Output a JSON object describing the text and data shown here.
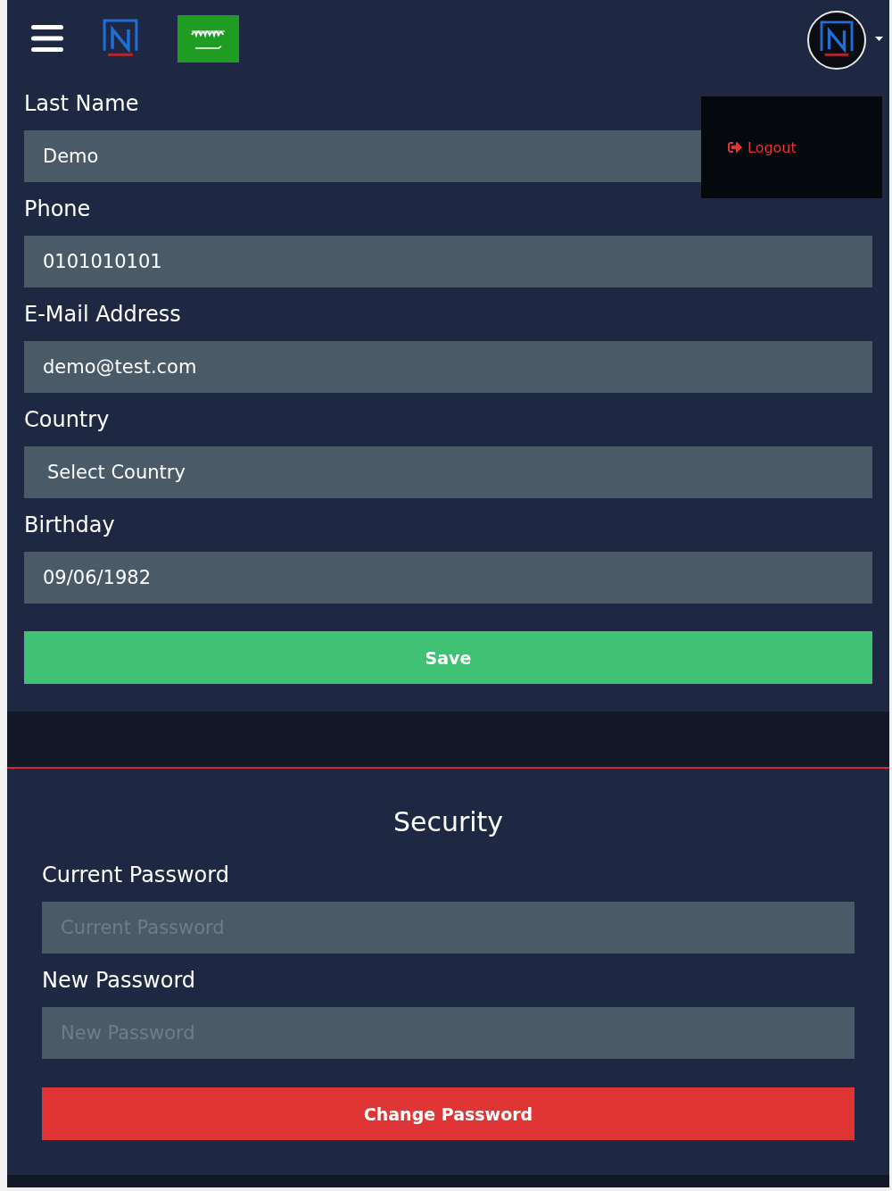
{
  "navbar": {
    "user_menu": {
      "expanded": true,
      "items": [
        {
          "label": "Logout"
        }
      ]
    }
  },
  "profile_form": {
    "fields": [
      {
        "label": "Last Name",
        "kind": "text",
        "value": "Demo"
      },
      {
        "label": "Phone",
        "kind": "text",
        "value": "0101010101"
      },
      {
        "label": "E-Mail Address",
        "kind": "text",
        "value": "demo@test.com"
      },
      {
        "label": "Country",
        "kind": "select",
        "value": "Select Country"
      },
      {
        "label": "Birthday",
        "kind": "text",
        "value": "09/06/1982"
      }
    ],
    "save_button": "Save"
  },
  "security": {
    "title": "Security",
    "fields": [
      {
        "label": "Current Password",
        "placeholder": "Current Password"
      },
      {
        "label": "New Password",
        "placeholder": "New Password"
      }
    ],
    "button": "Change Password"
  }
}
